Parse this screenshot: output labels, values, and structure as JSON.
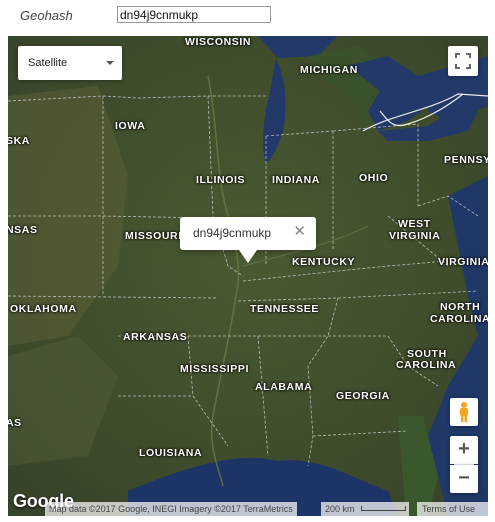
{
  "form": {
    "geohash_label": "Geohash",
    "geohash_value": "dn94j9cnmukp"
  },
  "map": {
    "map_type_label": "Satellite",
    "popup_text": "dn94j9cnmukp",
    "popup_close": "✕",
    "zoom_in": "+",
    "zoom_out": "−",
    "logo": "Google",
    "attribution": "Map data ©2017 Google, INEGI Imagery ©2017 TerraMetrics",
    "scale_text": "200 km",
    "terms": "Terms of Use",
    "labels": {
      "wisconsin": "WISCONSIN",
      "michigan": "MICHIGAN",
      "iowa": "IOWA",
      "ska": "SKA",
      "illinois": "ILLINOIS",
      "indiana": "INDIANA",
      "ohio": "OHIO",
      "pennsy": "PENNSY",
      "nsas": "NSAS",
      "missouri": "MISSOURI",
      "west_virginia_1": "WEST",
      "west_virginia_2": "VIRGINIA",
      "kentucky": "KENTUCKY",
      "virginia": "VIRGINIA",
      "oklahoma": "OKLAHOMA",
      "tennessee": "TENNESSEE",
      "north_carolina_1": "NORTH",
      "north_carolina_2": "CAROLINA",
      "arkansas": "ARKANSAS",
      "south_carolina_1": "SOUTH",
      "south_carolina_2": "CAROLINA",
      "mississippi": "MISSISSIPPI",
      "alabama": "ALABAMA",
      "georgia": "GEORGIA",
      "as": "AS",
      "louisiana": "LOUISIANA"
    },
    "colors": {
      "land": "#45532f",
      "water": "#1f3a6b",
      "border": "#d8d8d8"
    },
    "icons": [
      "fullscreen-icon",
      "pegman-icon",
      "dropdown-caret-icon",
      "close-icon"
    ]
  }
}
